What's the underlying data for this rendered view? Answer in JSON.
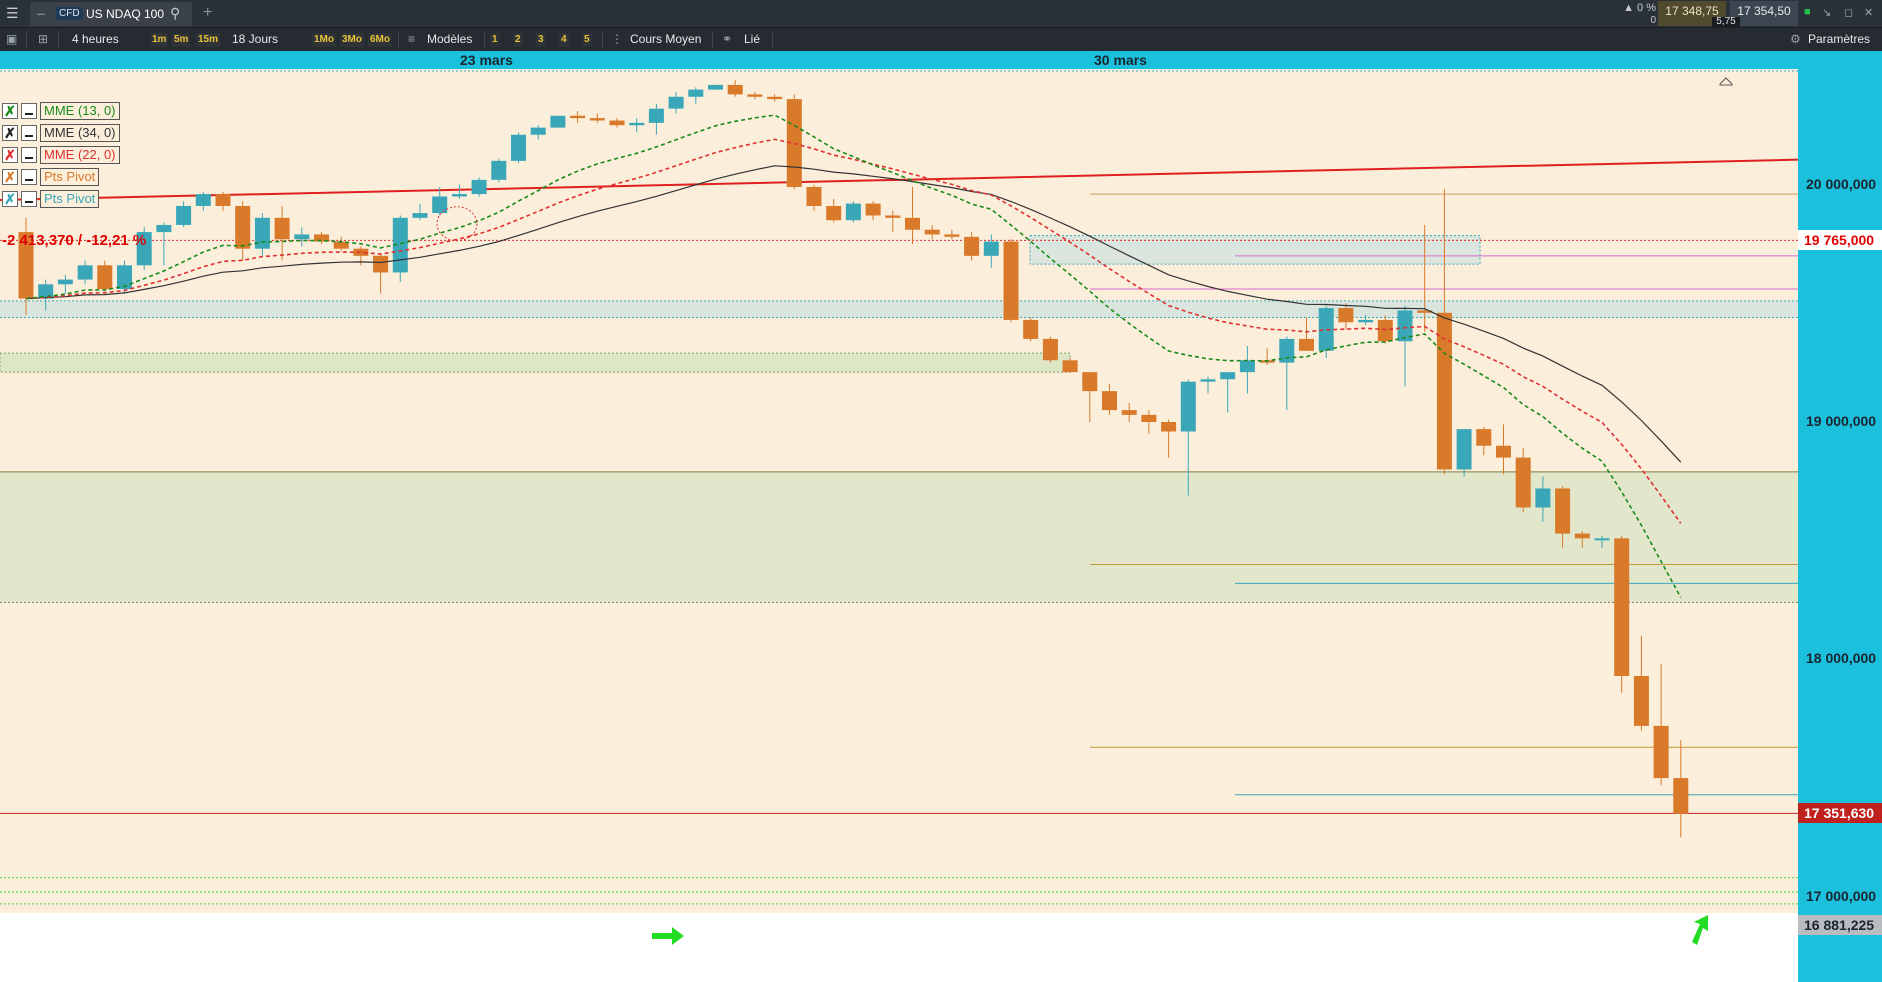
{
  "titlebar": {
    "instrument_type": "CFD",
    "instrument": "US NDAQ 100",
    "change_pct": "0 %",
    "change_abs": "0",
    "bid": "17 348,75",
    "ask": "17 354,50",
    "spread": "5,75"
  },
  "toolbar": {
    "period": "4 heures",
    "btn_1m": "1m",
    "btn_5m": "5m",
    "btn_15m": "15m",
    "range": "18 Jours",
    "btn_1mo": "1Mo",
    "btn_3mo": "3Mo",
    "btn_6mo": "6Mo",
    "models": "Modèles",
    "n1": "1",
    "n2": "2",
    "n3": "3",
    "n4": "4",
    "n5": "5",
    "price_type": "Cours Moyen",
    "link": "Lié",
    "settings": "Paramètres"
  },
  "dates": {
    "d1": "23 mars",
    "d2": "30 mars"
  },
  "legend": {
    "mme13": "MME (13, 0)",
    "mme34": "MME (34, 0)",
    "mme22": "MME (22, 0)",
    "pivot1": "Pts Pivot",
    "pivot2": "Pts Pivot"
  },
  "performance_label": "-2 413,370 / -12,21 %",
  "colors": {
    "up": "#3aa7b8",
    "down": "#d9792a",
    "mme13": "#1a8a1a",
    "mme22": "#e03030",
    "mme34": "#333333",
    "axis": "#1bc0dd"
  },
  "chart_data": {
    "type": "candlestick",
    "title": "US NDAQ 100",
    "timeframe": "4 heures",
    "ylim": [
      16881,
      20400
    ],
    "y_ticks": [
      17000000,
      18000000,
      19000000,
      20000000
    ],
    "y_tick_labels": [
      "17 000,000",
      "18 000,000",
      "19 000,000",
      "20 000,000"
    ],
    "price_tags": [
      {
        "label": "19 765,000",
        "value": 19765,
        "kind": "red-label"
      },
      {
        "label": "17 351,630",
        "value": 17351.63,
        "kind": "current"
      },
      {
        "label": "16 881,225",
        "value": 16881.225,
        "kind": "grey"
      }
    ],
    "x_labels": [
      "23 mars",
      "30 mars"
    ],
    "candles": [
      [
        19800,
        19860,
        19450,
        19520
      ],
      [
        19520,
        19600,
        19470,
        19580
      ],
      [
        19580,
        19620,
        19540,
        19600
      ],
      [
        19600,
        19680,
        19580,
        19660
      ],
      [
        19660,
        19680,
        19550,
        19560
      ],
      [
        19560,
        19680,
        19540,
        19660
      ],
      [
        19660,
        19820,
        19640,
        19800
      ],
      [
        19800,
        19840,
        19660,
        19830
      ],
      [
        19830,
        19930,
        19820,
        19910
      ],
      [
        19910,
        19970,
        19890,
        19960
      ],
      [
        19960,
        19970,
        19890,
        19910
      ],
      [
        19910,
        19930,
        19680,
        19730
      ],
      [
        19730,
        19880,
        19700,
        19860
      ],
      [
        19860,
        19910,
        19680,
        19770
      ],
      [
        19770,
        19820,
        19740,
        19790
      ],
      [
        19790,
        19800,
        19750,
        19760
      ],
      [
        19760,
        19780,
        19720,
        19730
      ],
      [
        19730,
        19740,
        19660,
        19700
      ],
      [
        19700,
        19710,
        19540,
        19630
      ],
      [
        19630,
        19870,
        19590,
        19860
      ],
      [
        19860,
        19920,
        19850,
        19880
      ],
      [
        19880,
        19990,
        19870,
        19950
      ],
      [
        19950,
        20000,
        19940,
        19960
      ],
      [
        19960,
        20030,
        19950,
        20020
      ],
      [
        20020,
        20110,
        20010,
        20100
      ],
      [
        20100,
        20220,
        20090,
        20210
      ],
      [
        20210,
        20250,
        20190,
        20240
      ],
      [
        20240,
        20290,
        20240,
        20290
      ],
      [
        20290,
        20310,
        20260,
        20280
      ],
      [
        20280,
        20300,
        20260,
        20270
      ],
      [
        20270,
        20280,
        20240,
        20250
      ],
      [
        20250,
        20280,
        20220,
        20260
      ],
      [
        20260,
        20340,
        20210,
        20320
      ],
      [
        20320,
        20390,
        20300,
        20370
      ],
      [
        20370,
        20410,
        20340,
        20400
      ],
      [
        20400,
        20420,
        20410,
        20420
      ],
      [
        20420,
        20440,
        20370,
        20380
      ],
      [
        20380,
        20390,
        20360,
        20370
      ],
      [
        20370,
        20380,
        20350,
        20360
      ],
      [
        20360,
        20380,
        19980,
        19990
      ],
      [
        19990,
        20000,
        19890,
        19910
      ],
      [
        19910,
        19940,
        19840,
        19850
      ],
      [
        19850,
        19930,
        19840,
        19920
      ],
      [
        19920,
        19930,
        19850,
        19870
      ],
      [
        19870,
        19890,
        19800,
        19860
      ],
      [
        19860,
        19990,
        19750,
        19810
      ],
      [
        19810,
        19830,
        19770,
        19790
      ],
      [
        19790,
        19810,
        19770,
        19780
      ],
      [
        19780,
        19800,
        19680,
        19700
      ],
      [
        19700,
        19790,
        19650,
        19760
      ],
      [
        19760,
        19770,
        19420,
        19430
      ],
      [
        19430,
        19440,
        19340,
        19350
      ],
      [
        19350,
        19360,
        19250,
        19260
      ],
      [
        19260,
        19270,
        19220,
        19210
      ],
      [
        19210,
        19200,
        19000,
        19130
      ],
      [
        19130,
        19160,
        19030,
        19050
      ],
      [
        19050,
        19080,
        19000,
        19030
      ],
      [
        19030,
        19050,
        18950,
        19000
      ],
      [
        19000,
        19010,
        18850,
        18960
      ],
      [
        18960,
        19180,
        18690,
        19170
      ],
      [
        19170,
        19190,
        19120,
        19180
      ],
      [
        19180,
        19200,
        19040,
        19210
      ],
      [
        19210,
        19320,
        19120,
        19260
      ],
      [
        19260,
        19310,
        19240,
        19250
      ],
      [
        19250,
        19360,
        19050,
        19350
      ],
      [
        19350,
        19440,
        19300,
        19300
      ],
      [
        19300,
        19490,
        19270,
        19480
      ],
      [
        19480,
        19500,
        19390,
        19420
      ],
      [
        19420,
        19450,
        19410,
        19430
      ],
      [
        19430,
        19450,
        19330,
        19340
      ],
      [
        19340,
        19490,
        19150,
        19470
      ],
      [
        19470,
        19830,
        19380,
        19460
      ],
      [
        19460,
        19980,
        18780,
        18800
      ],
      [
        18800,
        18970,
        18770,
        18970
      ],
      [
        18970,
        18980,
        18860,
        18900
      ],
      [
        18900,
        18990,
        18780,
        18850
      ],
      [
        18850,
        18890,
        18620,
        18640
      ],
      [
        18640,
        18770,
        18580,
        18720
      ],
      [
        18720,
        18730,
        18470,
        18530
      ],
      [
        18530,
        18540,
        18470,
        18510
      ],
      [
        18510,
        18520,
        18470,
        18510
      ],
      [
        18510,
        18520,
        17860,
        17930
      ],
      [
        17930,
        18100,
        17700,
        17720
      ],
      [
        17720,
        17980,
        17470,
        17500
      ],
      [
        17500,
        17660,
        17250,
        17350
      ]
    ],
    "indicators": [
      {
        "name": "MME (13, 0)",
        "style": "dashed",
        "color": "#1a8a1a"
      },
      {
        "name": "MME (22, 0)",
        "style": "dashed",
        "color": "#e03030"
      },
      {
        "name": "MME (34, 0)",
        "style": "solid",
        "color": "#333333"
      }
    ]
  }
}
